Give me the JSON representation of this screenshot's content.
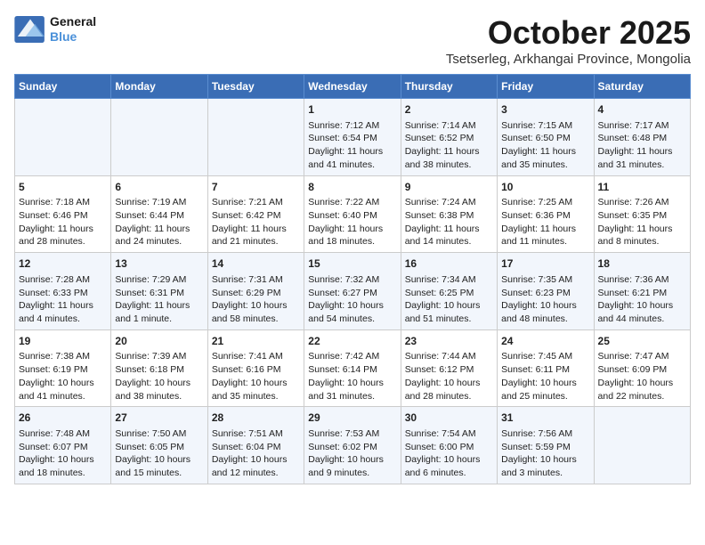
{
  "header": {
    "logo_line1": "General",
    "logo_line2": "Blue",
    "month": "October 2025",
    "location": "Tsetserleg, Arkhangai Province, Mongolia"
  },
  "weekdays": [
    "Sunday",
    "Monday",
    "Tuesday",
    "Wednesday",
    "Thursday",
    "Friday",
    "Saturday"
  ],
  "weeks": [
    [
      {
        "day": "",
        "info": ""
      },
      {
        "day": "",
        "info": ""
      },
      {
        "day": "",
        "info": ""
      },
      {
        "day": "1",
        "info": "Sunrise: 7:12 AM\nSunset: 6:54 PM\nDaylight: 11 hours and 41 minutes."
      },
      {
        "day": "2",
        "info": "Sunrise: 7:14 AM\nSunset: 6:52 PM\nDaylight: 11 hours and 38 minutes."
      },
      {
        "day": "3",
        "info": "Sunrise: 7:15 AM\nSunset: 6:50 PM\nDaylight: 11 hours and 35 minutes."
      },
      {
        "day": "4",
        "info": "Sunrise: 7:17 AM\nSunset: 6:48 PM\nDaylight: 11 hours and 31 minutes."
      }
    ],
    [
      {
        "day": "5",
        "info": "Sunrise: 7:18 AM\nSunset: 6:46 PM\nDaylight: 11 hours and 28 minutes."
      },
      {
        "day": "6",
        "info": "Sunrise: 7:19 AM\nSunset: 6:44 PM\nDaylight: 11 hours and 24 minutes."
      },
      {
        "day": "7",
        "info": "Sunrise: 7:21 AM\nSunset: 6:42 PM\nDaylight: 11 hours and 21 minutes."
      },
      {
        "day": "8",
        "info": "Sunrise: 7:22 AM\nSunset: 6:40 PM\nDaylight: 11 hours and 18 minutes."
      },
      {
        "day": "9",
        "info": "Sunrise: 7:24 AM\nSunset: 6:38 PM\nDaylight: 11 hours and 14 minutes."
      },
      {
        "day": "10",
        "info": "Sunrise: 7:25 AM\nSunset: 6:36 PM\nDaylight: 11 hours and 11 minutes."
      },
      {
        "day": "11",
        "info": "Sunrise: 7:26 AM\nSunset: 6:35 PM\nDaylight: 11 hours and 8 minutes."
      }
    ],
    [
      {
        "day": "12",
        "info": "Sunrise: 7:28 AM\nSunset: 6:33 PM\nDaylight: 11 hours and 4 minutes."
      },
      {
        "day": "13",
        "info": "Sunrise: 7:29 AM\nSunset: 6:31 PM\nDaylight: 11 hours and 1 minute."
      },
      {
        "day": "14",
        "info": "Sunrise: 7:31 AM\nSunset: 6:29 PM\nDaylight: 10 hours and 58 minutes."
      },
      {
        "day": "15",
        "info": "Sunrise: 7:32 AM\nSunset: 6:27 PM\nDaylight: 10 hours and 54 minutes."
      },
      {
        "day": "16",
        "info": "Sunrise: 7:34 AM\nSunset: 6:25 PM\nDaylight: 10 hours and 51 minutes."
      },
      {
        "day": "17",
        "info": "Sunrise: 7:35 AM\nSunset: 6:23 PM\nDaylight: 10 hours and 48 minutes."
      },
      {
        "day": "18",
        "info": "Sunrise: 7:36 AM\nSunset: 6:21 PM\nDaylight: 10 hours and 44 minutes."
      }
    ],
    [
      {
        "day": "19",
        "info": "Sunrise: 7:38 AM\nSunset: 6:19 PM\nDaylight: 10 hours and 41 minutes."
      },
      {
        "day": "20",
        "info": "Sunrise: 7:39 AM\nSunset: 6:18 PM\nDaylight: 10 hours and 38 minutes."
      },
      {
        "day": "21",
        "info": "Sunrise: 7:41 AM\nSunset: 6:16 PM\nDaylight: 10 hours and 35 minutes."
      },
      {
        "day": "22",
        "info": "Sunrise: 7:42 AM\nSunset: 6:14 PM\nDaylight: 10 hours and 31 minutes."
      },
      {
        "day": "23",
        "info": "Sunrise: 7:44 AM\nSunset: 6:12 PM\nDaylight: 10 hours and 28 minutes."
      },
      {
        "day": "24",
        "info": "Sunrise: 7:45 AM\nSunset: 6:11 PM\nDaylight: 10 hours and 25 minutes."
      },
      {
        "day": "25",
        "info": "Sunrise: 7:47 AM\nSunset: 6:09 PM\nDaylight: 10 hours and 22 minutes."
      }
    ],
    [
      {
        "day": "26",
        "info": "Sunrise: 7:48 AM\nSunset: 6:07 PM\nDaylight: 10 hours and 18 minutes."
      },
      {
        "day": "27",
        "info": "Sunrise: 7:50 AM\nSunset: 6:05 PM\nDaylight: 10 hours and 15 minutes."
      },
      {
        "day": "28",
        "info": "Sunrise: 7:51 AM\nSunset: 6:04 PM\nDaylight: 10 hours and 12 minutes."
      },
      {
        "day": "29",
        "info": "Sunrise: 7:53 AM\nSunset: 6:02 PM\nDaylight: 10 hours and 9 minutes."
      },
      {
        "day": "30",
        "info": "Sunrise: 7:54 AM\nSunset: 6:00 PM\nDaylight: 10 hours and 6 minutes."
      },
      {
        "day": "31",
        "info": "Sunrise: 7:56 AM\nSunset: 5:59 PM\nDaylight: 10 hours and 3 minutes."
      },
      {
        "day": "",
        "info": ""
      }
    ]
  ]
}
